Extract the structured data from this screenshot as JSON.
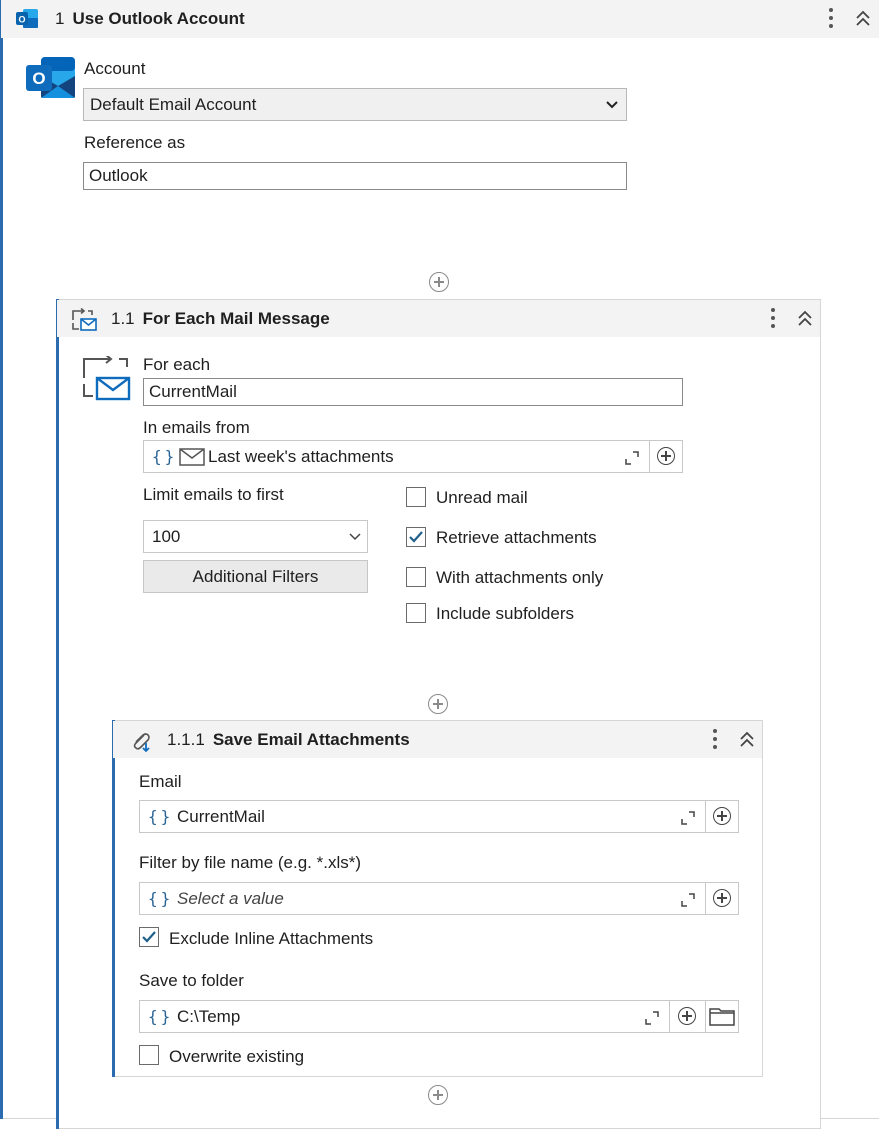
{
  "outer": {
    "number": "1",
    "title": "Use Outlook Account",
    "account_label": "Account",
    "account_value": "Default Email Account",
    "reference_label": "Reference as",
    "reference_value": "Outlook"
  },
  "foreach": {
    "number": "1.1",
    "title": "For Each Mail Message",
    "for_each_label": "For each",
    "for_each_value": "CurrentMail",
    "in_emails_label": "In emails from",
    "in_emails_brace": "{}",
    "in_emails_value": "Last week's attachments",
    "limit_label": "Limit emails to first",
    "limit_value": "100",
    "filters_button": "Additional Filters",
    "checkboxes": [
      {
        "label": "Unread mail",
        "checked": false
      },
      {
        "label": "Retrieve attachments",
        "checked": true
      },
      {
        "label": "With attachments only",
        "checked": false
      },
      {
        "label": "Include subfolders",
        "checked": false
      }
    ]
  },
  "save": {
    "number": "1.1.1",
    "title": "Save Email Attachments",
    "email_label": "Email",
    "email_brace": "{}",
    "email_value": "CurrentMail",
    "filter_label": "Filter by file name (e.g. *.xls*)",
    "filter_brace": "{}",
    "filter_placeholder": "Select a value",
    "exclude_label": "Exclude Inline Attachments",
    "exclude_checked": true,
    "folder_label": "Save to folder",
    "folder_brace": "{}",
    "folder_value": "C:\\Temp",
    "overwrite_label": "Overwrite existing",
    "overwrite_checked": false
  },
  "colors": {
    "accent": "#2b6cb0",
    "outlook_blue": "#0f6cbd",
    "header_bg": "#f3f3f3",
    "checkmark": "#1f5f8b"
  },
  "icons": [
    "outlook-icon",
    "kebab-menu-icon",
    "collapse-icon",
    "for-each-mail-icon",
    "envelope-icon",
    "attachment-icon",
    "expand-icon",
    "plus-circle-icon",
    "folder-icon",
    "chevron-down-icon",
    "checkmark-icon"
  ]
}
